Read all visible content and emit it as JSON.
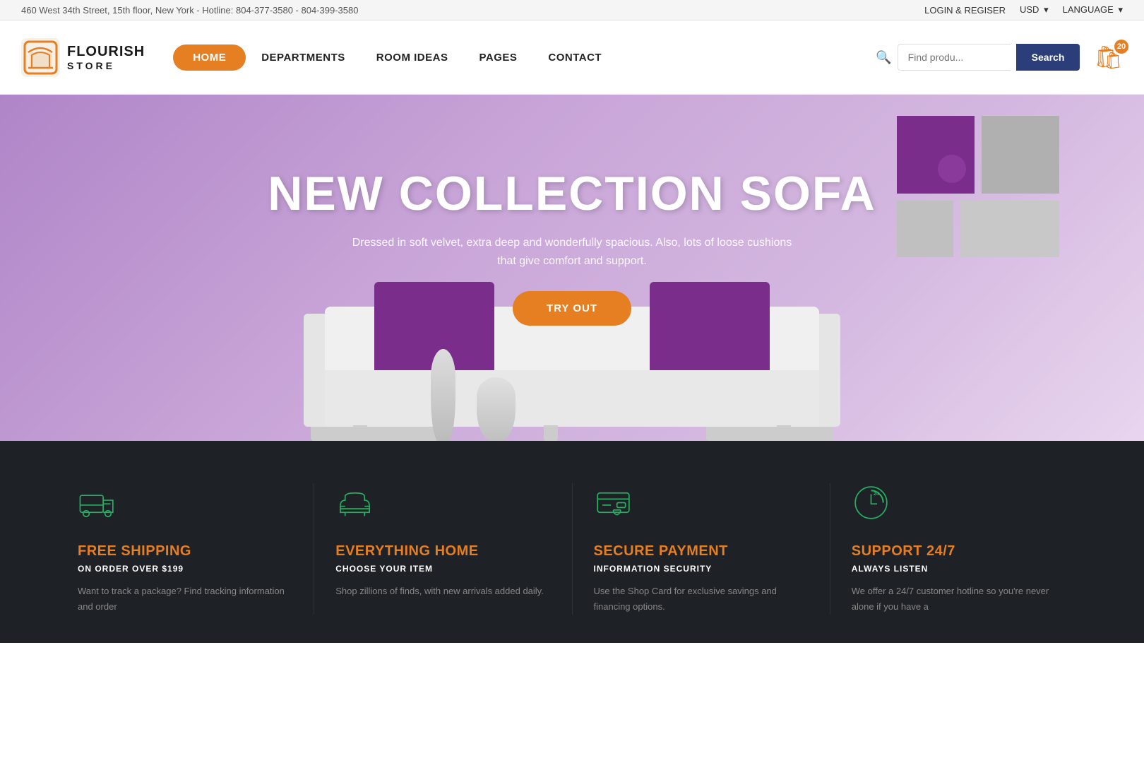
{
  "topbar": {
    "address": "460 West 34th Street, 15th floor, New York - Hotline: 804-377-3580 - 804-399-3580",
    "login": "LOGIN & REGISER",
    "currency": "USD",
    "currency_arrow": "▾",
    "language": "LANGUAGE",
    "language_arrow": "▾"
  },
  "logo": {
    "flourish": "FLOURISH",
    "store": "STORE"
  },
  "nav": {
    "items": [
      {
        "label": "HOME",
        "active": true
      },
      {
        "label": "DEPARTMENTS",
        "active": false
      },
      {
        "label": "ROOM IDEAS",
        "active": false
      },
      {
        "label": "PAGES",
        "active": false
      },
      {
        "label": "CONTACT",
        "active": false
      }
    ]
  },
  "search": {
    "placeholder": "Find produ...",
    "button_label": "Search"
  },
  "cart": {
    "count": "20"
  },
  "hero": {
    "title": "NEW COLLECTION SOFA",
    "subtitle": "Dressed in soft velvet, extra deep and wonderfully spacious. Also, lots of loose cushions that give comfort and support.",
    "cta_label": "TRY OUT"
  },
  "features": [
    {
      "id": "shipping",
      "icon": "truck-icon",
      "title": "FREE SHIPPING",
      "subtitle": "ON ORDER OVER $199",
      "description": "Want to track a package? Find tracking information and order"
    },
    {
      "id": "home",
      "icon": "sofa-icon",
      "title": "EVERYTHING HOME",
      "subtitle": "CHOOSE YOUR ITEM",
      "description": "Shop zillions of finds, with new arrivals added daily."
    },
    {
      "id": "payment",
      "icon": "card-icon",
      "title": "SECURE PAYMENT",
      "subtitle": "INFORMATION SECURITY",
      "description": "Use the Shop Card for exclusive savings and financing options."
    },
    {
      "id": "support",
      "icon": "support-icon",
      "title": "SUPPORT 24/7",
      "subtitle": "ALWAYS LISTEN",
      "description": "We offer a 24/7 customer hotline so you're never alone if you have a"
    }
  ]
}
